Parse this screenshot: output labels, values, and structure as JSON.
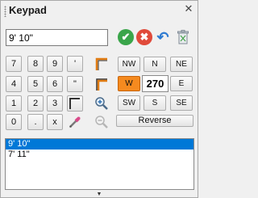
{
  "window": {
    "title": "Keypad",
    "close_glyph": "✕"
  },
  "input": {
    "value": "9' 10\""
  },
  "actions": {
    "accept_glyph": "✔",
    "cancel_glyph": "✖",
    "undo_glyph": "↶",
    "accept_color": "#3aa54a",
    "cancel_color": "#e04a3a",
    "undo_color": "#2e7bd1"
  },
  "keypad": {
    "keys": [
      "7",
      "8",
      "9",
      "'",
      "4",
      "5",
      "6",
      "\"",
      "1",
      "2",
      "3",
      "0",
      ".",
      "x"
    ]
  },
  "directions": {
    "nw": "NW",
    "n": "N",
    "ne": "NE",
    "w": "W",
    "e": "E",
    "sw": "SW",
    "s": "S",
    "se": "SE",
    "angle": "270",
    "active": "W",
    "active_color": "#f58a1f"
  },
  "reverse_label": "Reverse",
  "history": {
    "items": [
      "9' 10\"",
      "7' 11\""
    ],
    "selected_index": 0
  },
  "bottom_grip_glyph": "▼"
}
